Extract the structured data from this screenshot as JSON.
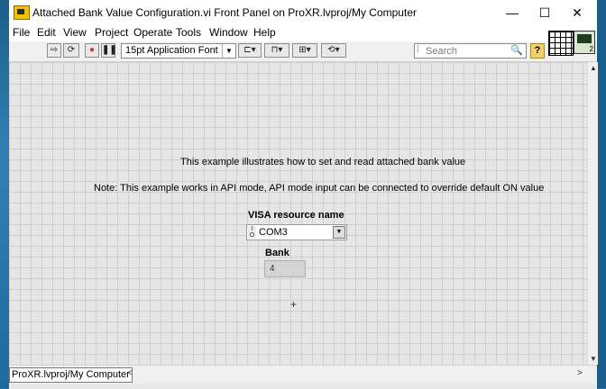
{
  "window": {
    "title": "Attached Bank Value Configuration.vi Front Panel on ProXR.lvproj/My Computer",
    "minimize_glyph": "—",
    "maximize_glyph": "☐",
    "close_glyph": "✕"
  },
  "menu": {
    "items": [
      "File",
      "Edit",
      "View",
      "Project",
      "Operate",
      "Tools",
      "Window",
      "Help"
    ]
  },
  "toolbar": {
    "run_icon": "run-arrow-icon",
    "run_continuous_icon": "run-continuously-icon",
    "abort_icon": "abort-icon",
    "pause_icon": "pause-icon",
    "font_value": "15pt Application Font",
    "search_placeholder": "Search",
    "help_label": "?"
  },
  "panel": {
    "description": "This example illustrates how to set and read attached bank value",
    "note": "Note: This example works in API mode, API mode input can be connected to override default ON value",
    "visa_label": "VISA resource name",
    "visa_value": "COM3",
    "bank_label": "Bank",
    "bank_value": "4"
  },
  "status": {
    "project": "ProXR.lvproj/My Computer"
  },
  "colors": {
    "panel_bg": "#e6e6e6",
    "grid": "#cfcfcf",
    "desktop": "#2a6f98"
  }
}
